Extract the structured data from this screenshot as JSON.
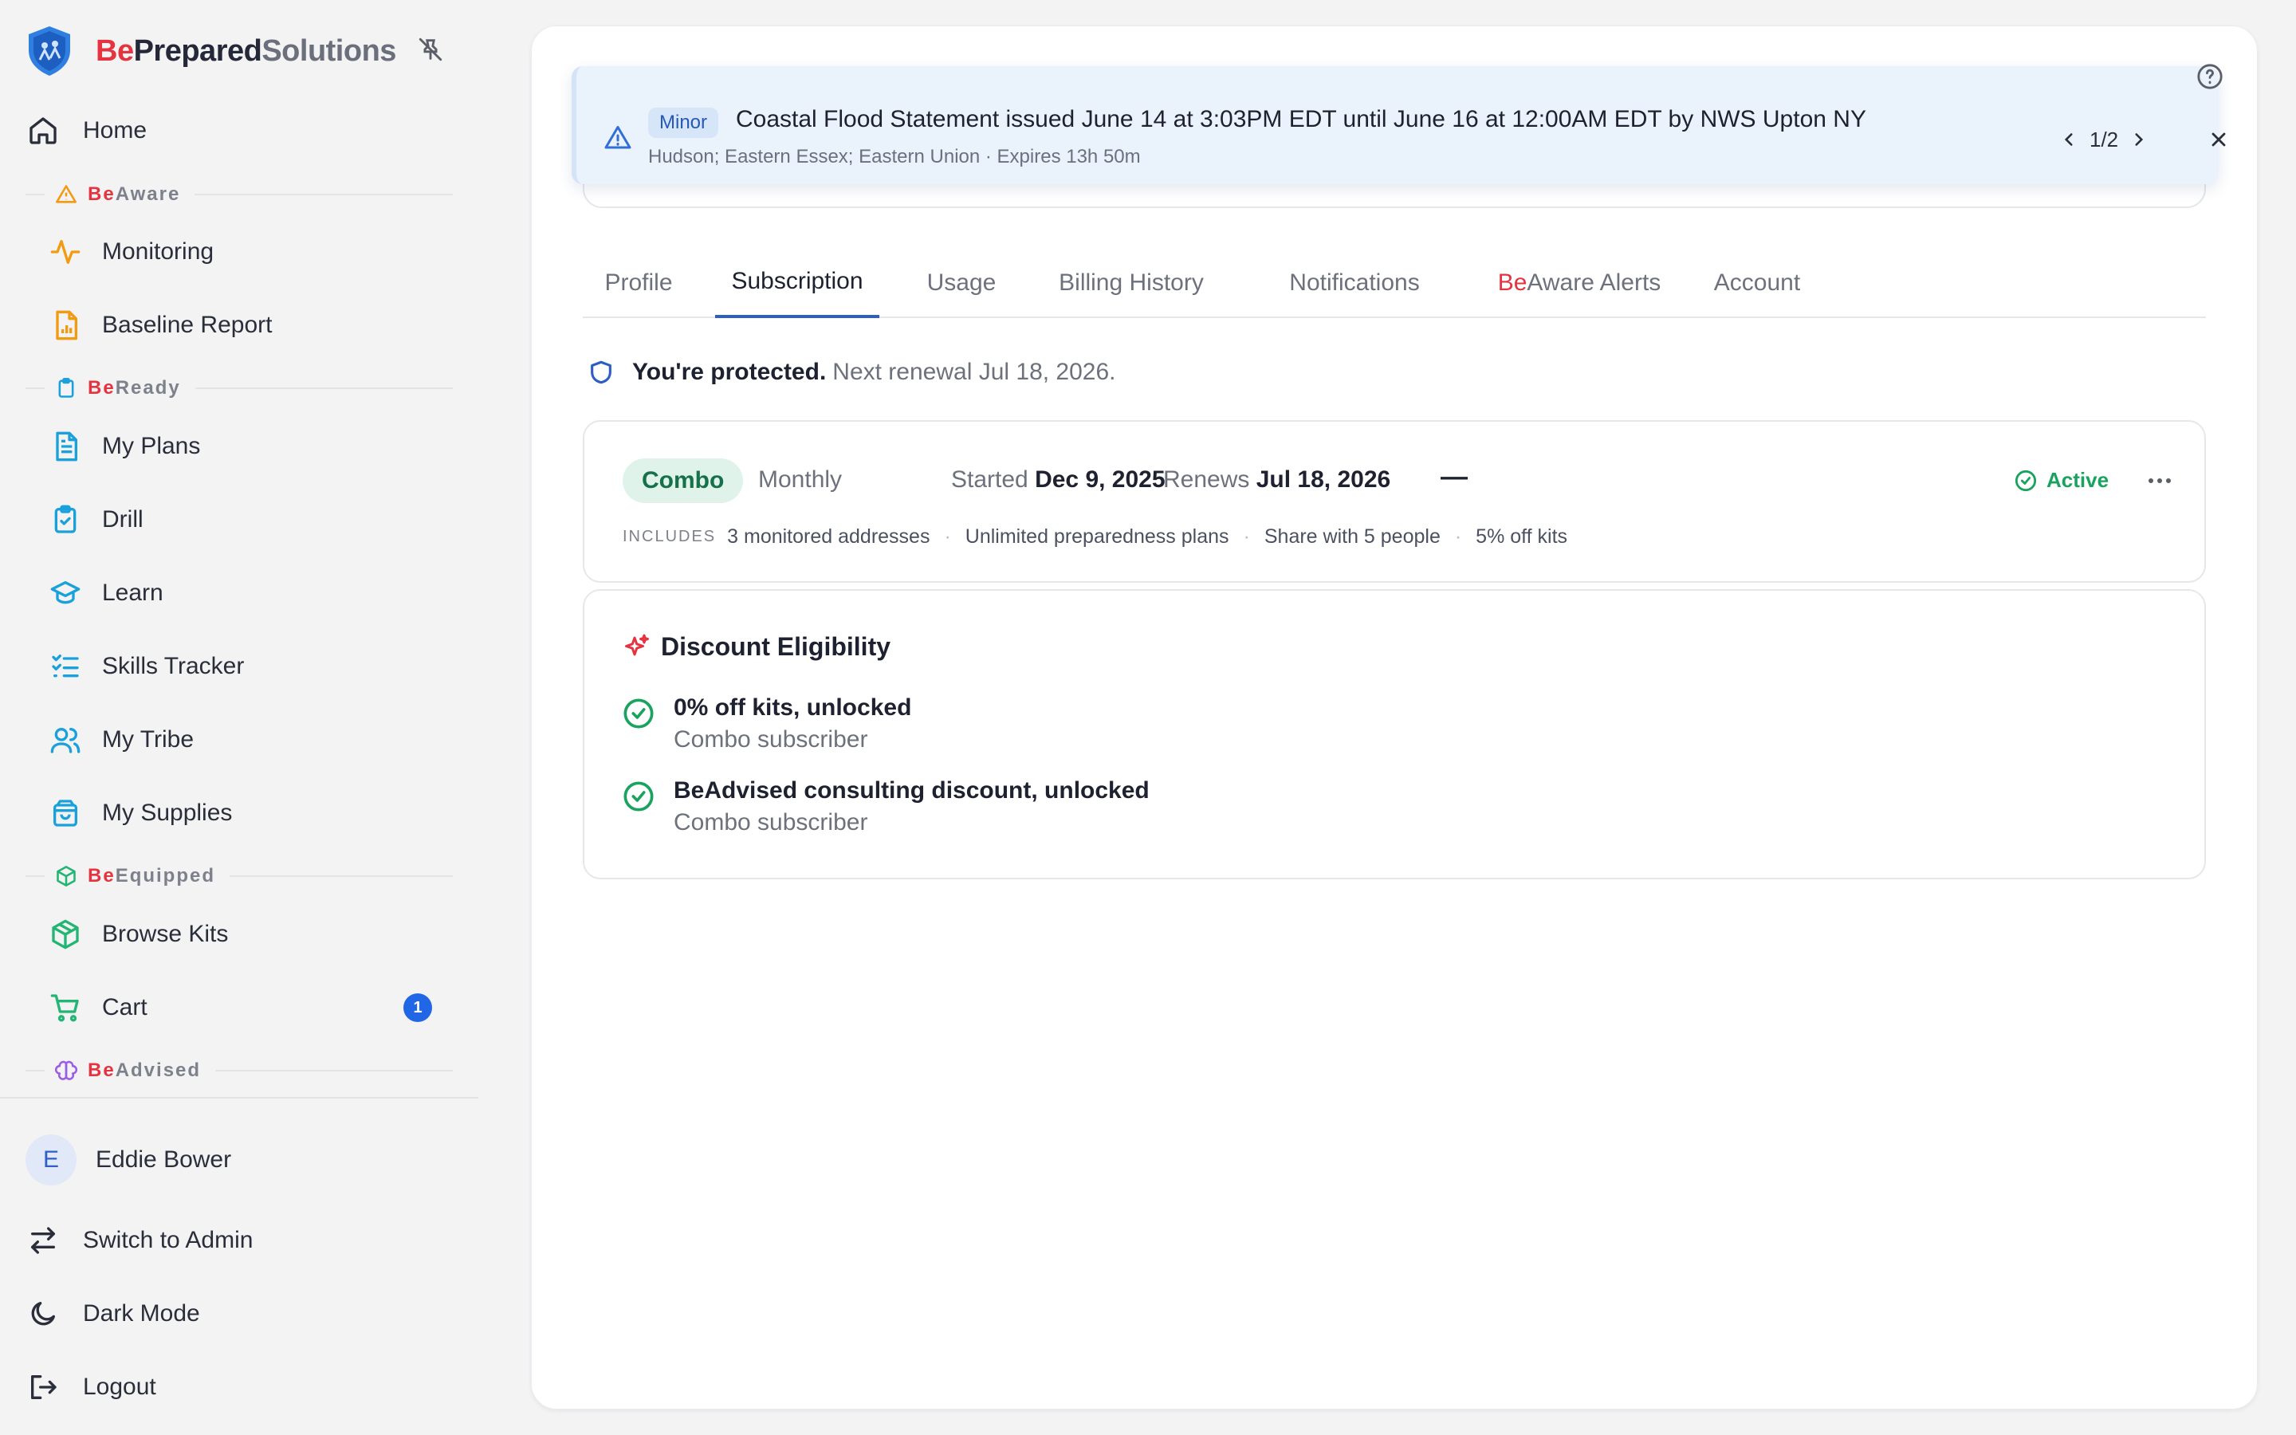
{
  "brand": {
    "be": "Be",
    "prepared": "Prepared",
    "solutions": "Solutions"
  },
  "nav": {
    "home": "Home",
    "sections": {
      "beaware": {
        "be": "Be",
        "rest": "Aware"
      },
      "beready": {
        "be": "Be",
        "rest": "Ready"
      },
      "beequipped": {
        "be": "Be",
        "rest": "Equipped"
      },
      "beadvised": {
        "be": "Be",
        "rest": "Advised"
      }
    },
    "items": {
      "monitoring": "Monitoring",
      "baseline_report": "Baseline Report",
      "my_plans": "My Plans",
      "drill": "Drill",
      "learn": "Learn",
      "skills_tracker": "Skills Tracker",
      "my_tribe": "My Tribe",
      "my_supplies": "My Supplies",
      "browse_kits": "Browse Kits",
      "cart": "Cart"
    },
    "cart_count": "1"
  },
  "user": {
    "initial": "E",
    "name": "Eddie Bower"
  },
  "footer": {
    "switch_admin": "Switch to Admin",
    "dark_mode": "Dark Mode",
    "logout": "Logout"
  },
  "alert": {
    "severity": "Minor",
    "title": "Coastal Flood Statement issued June 14 at 3:03PM EDT until June 16 at 12:00AM EDT by NWS Upton NY",
    "subtitle": "Hudson; Eastern Essex; Eastern Union · Expires 13h 50m",
    "pager": "1/2"
  },
  "tabs": {
    "profile": "Profile",
    "subscription": "Subscription",
    "usage": "Usage",
    "billing_history": "Billing History",
    "notifications": "Notifications",
    "beaware_alerts_be": "Be",
    "beaware_alerts_rest": "Aware Alerts",
    "account": "Account"
  },
  "protected": {
    "strong": "You're protected.",
    "rest": "Next renewal Jul 18, 2026."
  },
  "subscription": {
    "plan": "Combo",
    "cycle": "Monthly",
    "started_label": "Started",
    "started_date": "Dec 9, 2025",
    "renews_label": "Renews",
    "renews_date": "Jul 18, 2026",
    "dash": "—",
    "status": "Active",
    "includes_label": "INCLUDES",
    "includes": [
      "3 monitored addresses",
      "Unlimited preparedness plans",
      "Share with 5 people",
      "5% off kits"
    ]
  },
  "discount": {
    "title": "Discount Eligibility",
    "items": [
      {
        "title": "0% off kits, unlocked",
        "sub": "Combo subscriber"
      },
      {
        "title": "BeAdvised consulting discount, unlocked",
        "sub": "Combo subscriber"
      }
    ]
  },
  "colors": {
    "accent_red": "#e53340",
    "primary_blue": "#2166e5",
    "success_green": "#19a35f",
    "aware_orange": "#f29a11",
    "ready_blue": "#1aa1dc",
    "equipped_green": "#22b573",
    "advised_purple": "#9b5de5"
  }
}
